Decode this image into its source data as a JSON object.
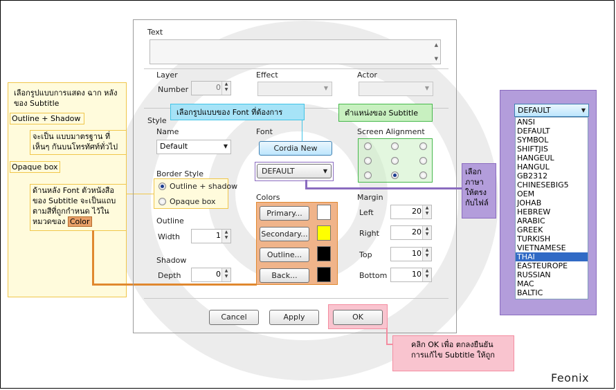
{
  "dialog": {
    "text_label": "Text",
    "layer_label": "Layer",
    "number_label": "Number",
    "number_value": "0",
    "effect_label": "Effect",
    "actor_label": "Actor",
    "style_label": "Style",
    "name_label": "Name",
    "name_value": "Default",
    "font_label": "Font",
    "font_button": "Cordia New",
    "screen_alignment_label": "Screen Alignment",
    "border_style_label": "Border Style",
    "outline_shadow_option": "Outline + shadow",
    "opaque_box_option": "Opaque box",
    "charset_value": "DEFAULT",
    "outline_label": "Outline",
    "width_label": "Width",
    "width_value": "1",
    "shadow_label": "Shadow",
    "depth_label": "Depth",
    "depth_value": "0",
    "colors_label": "Colors",
    "primary_button": "Primary...",
    "secondary_button": "Secondary...",
    "outline_button": "Outline...",
    "back_button": "Back...",
    "margin_label": "Margin",
    "left_label": "Left",
    "left_value": "20",
    "right_label": "Right",
    "right_value": "20",
    "top_label": "Top",
    "top_value": "10",
    "bottom_label": "Bottom",
    "bottom_value": "10",
    "cancel_button": "Cancel",
    "apply_button": "Apply",
    "ok_button": "OK"
  },
  "colors": {
    "primary": "#ffffff",
    "secondary": "#ffff00",
    "outline": "#000000",
    "back": "#000000",
    "annotation_orange": "#e0882f",
    "annotation_blue": "#3fc3e6",
    "annotation_green": "#45b84a",
    "annotation_purple": "#b39ddb",
    "annotation_pink": "#f48ca0"
  },
  "annotations": {
    "style_title": "เลือกรูปแบบการแสดง ฉาก หลังของ Subtitle",
    "outline_shadow_tag": "Outline + Shadow",
    "outline_shadow_desc": "จะเป็น แบบมาตรฐาน ที่เห็นๆ กันบนโทรทัศท์ทั่วไป",
    "opaque_box_tag": "Opaque box",
    "opaque_box_desc_1": "ด้านหลัง Font ตัวหนังสือ ของ Subtitle จะเป็นแถบ ตามสีที่ถูกกำหนด ไว้ใน หมวดของ",
    "opaque_box_desc_color": "Color",
    "font_note": "เลือกรูปแบบของ Font ที่ต้องการ",
    "position_note": "ตำแหน่งของ Subtitle",
    "language_note": "เลือก ภาษา ให้ตรง กับไฟล์",
    "ok_note": "คลิก OK เพื่อ ตกลงยืนยัน การแก้ไข Subtitle ให้ถูก"
  },
  "charset_dropdown": {
    "selected": "DEFAULT",
    "options": [
      "ANSI",
      "DEFAULT",
      "SYMBOL",
      "SHIFTJIS",
      "HANGEUL",
      "HANGUL",
      "GB2312",
      "CHINESEBIG5",
      "OEM",
      "JOHAB",
      "HEBREW",
      "ARABIC",
      "GREEK",
      "TURKISH",
      "VIETNAMESE",
      "THAI",
      "EASTEUROPE",
      "RUSSIAN",
      "MAC",
      "BALTIC"
    ],
    "highlighted": "THAI"
  },
  "watermark": "Feonix"
}
